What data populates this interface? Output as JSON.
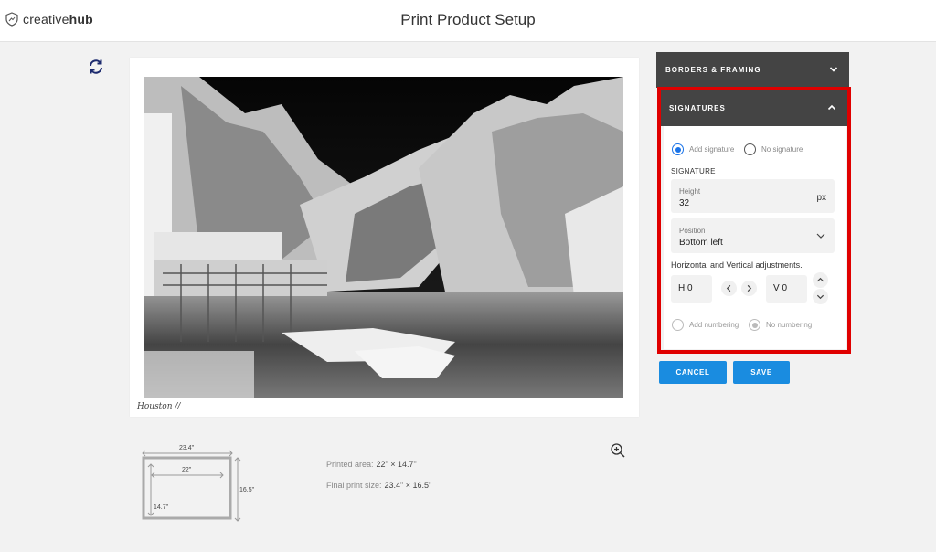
{
  "header": {
    "logo_prefix": "creative",
    "logo_suffix": "hub",
    "title": "Print Product Setup"
  },
  "preview": {
    "signature_text": "Houston //"
  },
  "dimensions": {
    "outer_width": "23.4\"",
    "inner_width": "22\"",
    "outer_height": "16.5\"",
    "inner_height": "14.7\""
  },
  "info": {
    "printed_area_label": "Printed area:",
    "printed_area_value": "22\" × 14.7\"",
    "final_size_label": "Final print size:",
    "final_size_value": "23.4\" × 16.5\""
  },
  "panel": {
    "borders_title": "BORDERS & FRAMING",
    "signatures_title": "SIGNATURES",
    "add_signature": "Add signature",
    "no_signature": "No signature",
    "signature_section": "SIGNATURE",
    "height_label": "Height",
    "height_value": "32",
    "height_unit": "px",
    "position_label": "Position",
    "position_value": "Bottom left",
    "adjust_label": "Horizontal and Vertical adjustments.",
    "h_value": "H 0",
    "v_value": "V 0",
    "add_numbering": "Add numbering",
    "no_numbering": "No numbering"
  },
  "actions": {
    "cancel": "CANCEL",
    "save": "SAVE"
  },
  "colors": {
    "accent": "#1a8ce0",
    "header_dark": "#444444",
    "highlight": "#e00000"
  }
}
